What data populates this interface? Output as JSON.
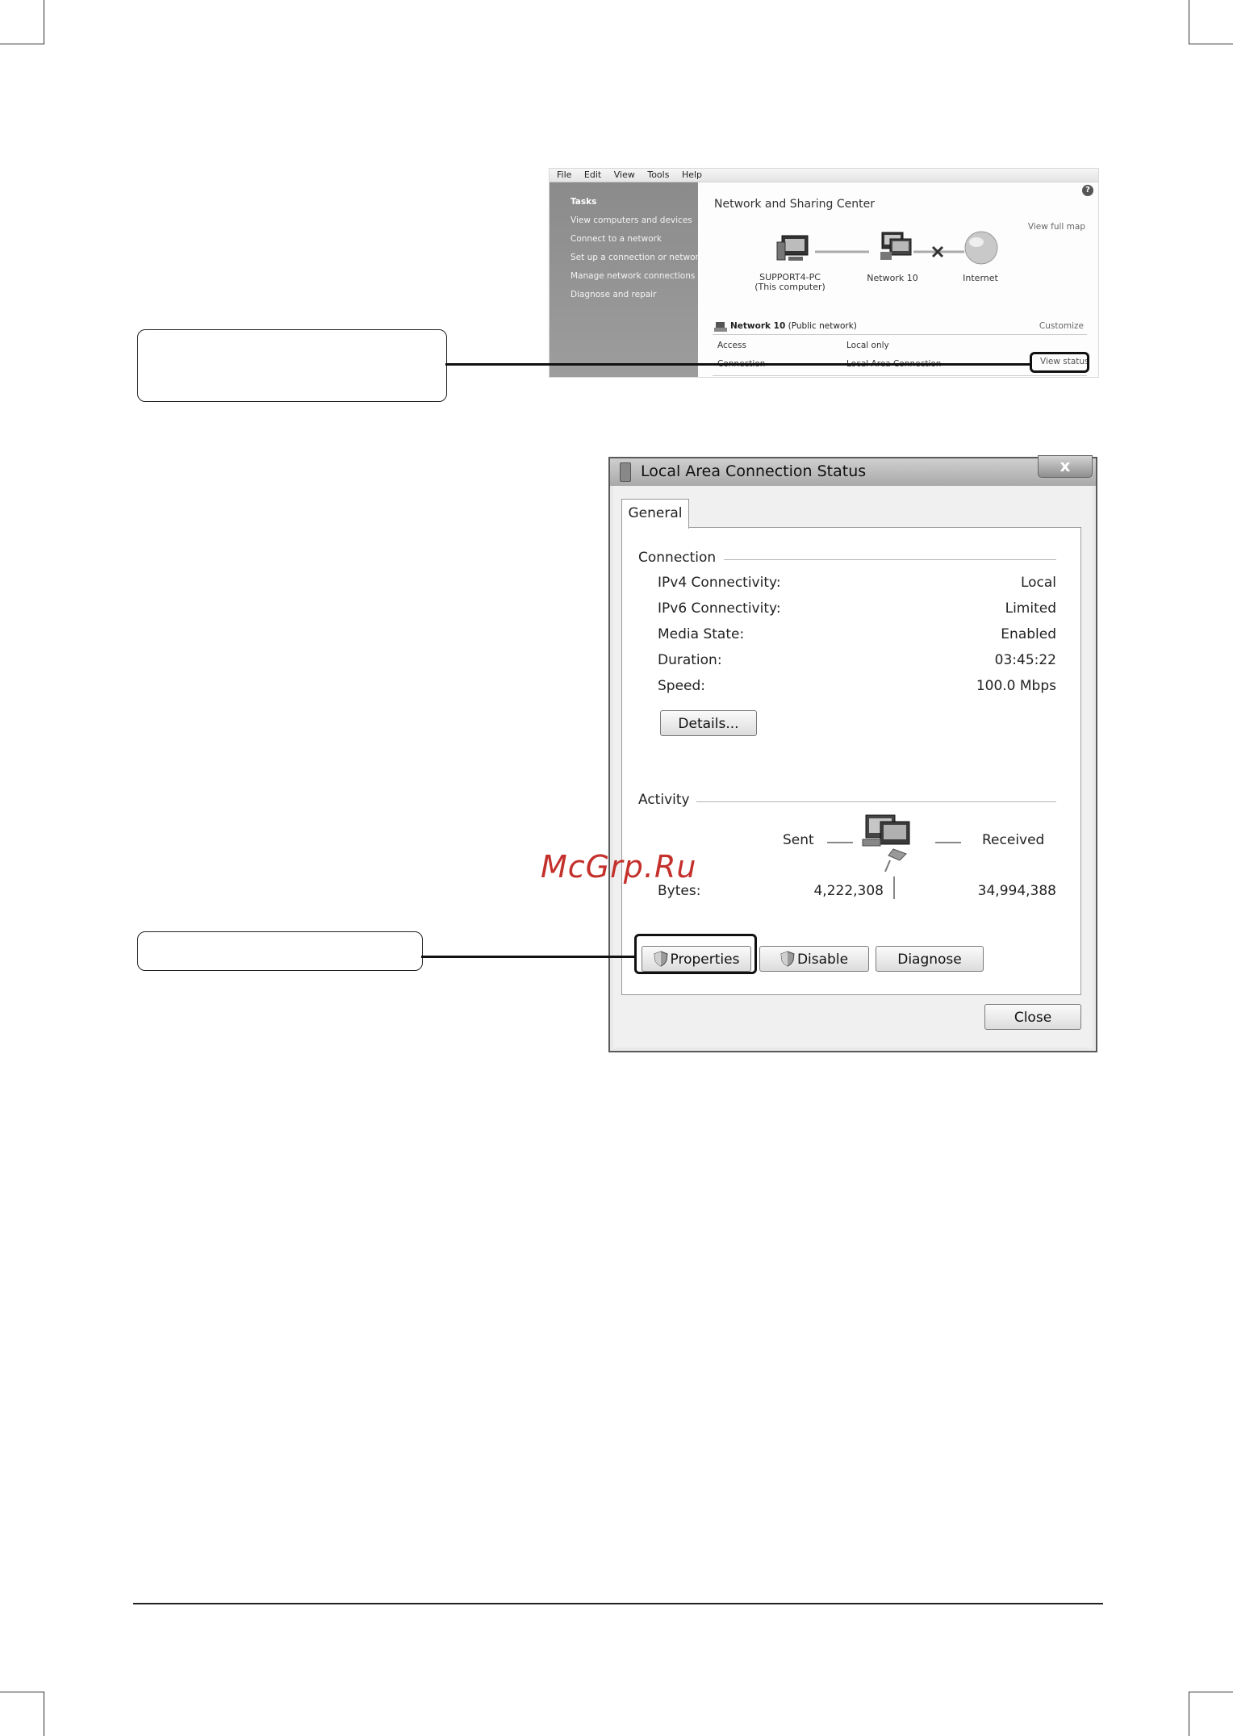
{
  "nsc": {
    "menu": [
      "File",
      "Edit",
      "View",
      "Tools",
      "Help"
    ],
    "help_glyph": "?",
    "tasks_header": "Tasks",
    "tasks": [
      "View computers and devices",
      "Connect to a network",
      "Set up a connection or network",
      "Manage network connections",
      "Diagnose and repair"
    ],
    "title": "Network and Sharing Center",
    "view_full_map": "View full map",
    "computer_name": "SUPPORT4-PC",
    "computer_sub": "(This computer)",
    "network_node": "Network 10",
    "internet_node": "Internet",
    "network_name": "Network  10",
    "network_type": "(Public network)",
    "customize": "Customize",
    "access_label": "Access",
    "access_value": "Local only",
    "connection_label": "Connection",
    "connection_value": "Local Area Connection",
    "view_status": "View status"
  },
  "dialog": {
    "title": "Local Area Connection Status",
    "close_glyph": "x",
    "tab": "General",
    "connection_group": "Connection",
    "rows": [
      {
        "label": "IPv4 Connectivity:",
        "value": "Local"
      },
      {
        "label": "IPv6 Connectivity:",
        "value": "Limited"
      },
      {
        "label": "Media State:",
        "value": "Enabled"
      },
      {
        "label": "Duration:",
        "value": "03:45:22"
      },
      {
        "label": "Speed:",
        "value": "100.0 Mbps"
      }
    ],
    "details_button": "Details...",
    "activity_group": "Activity",
    "sent_label": "Sent",
    "received_label": "Received",
    "bytes_label": "Bytes:",
    "bytes_sent": "4,222,308",
    "bytes_received": "34,994,388",
    "properties_button": "Properties",
    "disable_button": "Disable",
    "diagnose_button": "Diagnose",
    "close_button": "Close"
  },
  "watermark": "McGrp.Ru",
  "colors": {
    "watermark": "#c4302b",
    "sidebar": "#8b8b8b"
  }
}
